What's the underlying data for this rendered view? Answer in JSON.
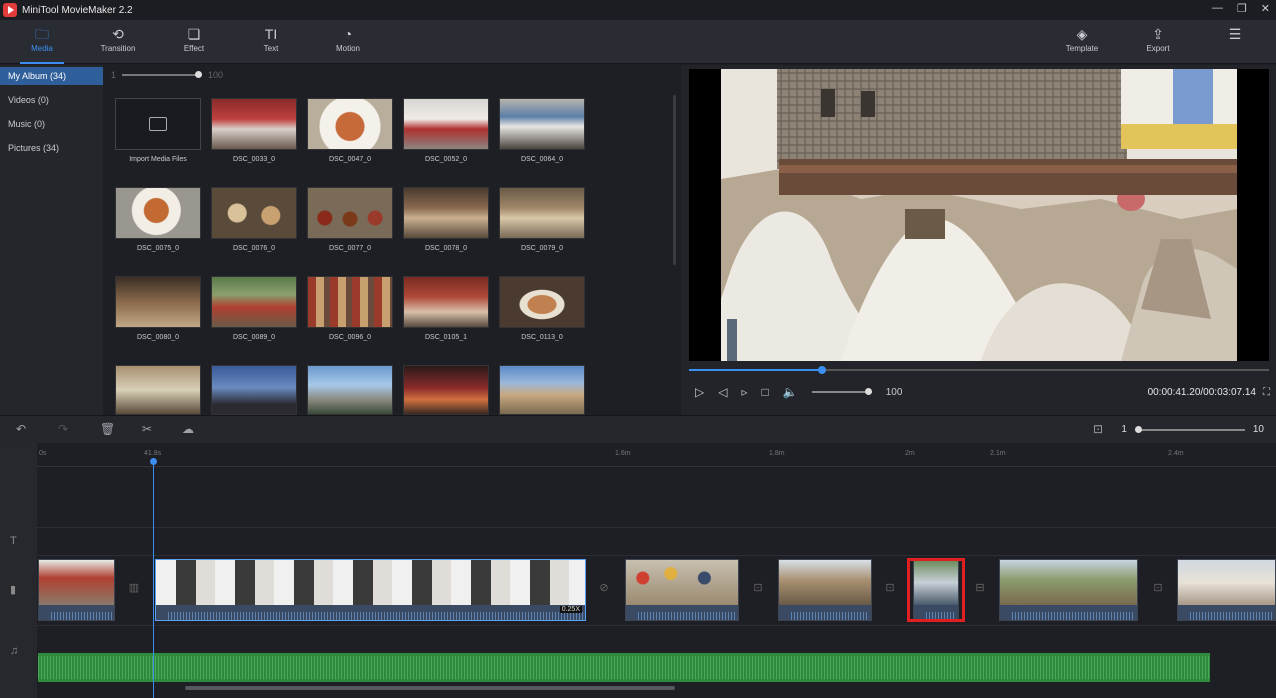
{
  "app": {
    "title": "MiniTool MovieMaker 2.2"
  },
  "toolbar": {
    "media": "Media",
    "transition": "Transition",
    "effect": "Effect",
    "text": "Text",
    "motion": "Motion",
    "template": "Template",
    "export": "Export"
  },
  "sidebar": {
    "items": [
      {
        "label": "My Album (34)"
      },
      {
        "label": "Videos (0)"
      },
      {
        "label": "Music (0)"
      },
      {
        "label": "Pictures (34)"
      }
    ]
  },
  "library": {
    "zoom_min": "1",
    "zoom_max": "100",
    "import_label": "Import Media Files",
    "items": [
      "DSC_0033_0",
      "DSC_0047_0",
      "DSC_0052_0",
      "DSC_0064_0",
      "DSC_0075_0",
      "DSC_0076_0",
      "DSC_0077_0",
      "DSC_0078_0",
      "DSC_0079_0",
      "DSC_0080_0",
      "DSC_0089_0",
      "DSC_0096_0",
      "DSC_0105_1",
      "DSC_0113_0"
    ]
  },
  "preview": {
    "volume": "100",
    "time": "00:00:41.20/00:03:07.14",
    "progress_fraction": 0.23
  },
  "timeline": {
    "zoom_min": "1",
    "zoom_max": "10",
    "ruler": [
      "0s",
      "41.8s",
      "1.6m",
      "1.8m",
      "2m",
      "2.1m",
      "2.4m"
    ],
    "clip_badge": "0.25X"
  },
  "colors": {
    "accent": "#3b8ff0",
    "highlight": "#e02020",
    "audio": "#2e8a3c"
  }
}
